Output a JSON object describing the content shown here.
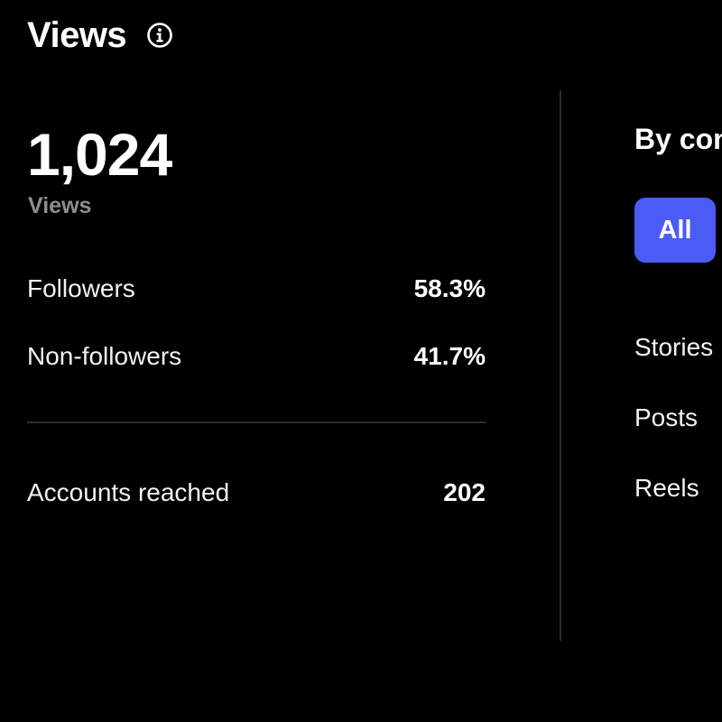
{
  "header": {
    "title": "Views",
    "info_icon": "info-circle-icon"
  },
  "summary": {
    "total": "1,024",
    "total_label": "Views"
  },
  "audience": [
    {
      "label": "Followers",
      "value": "58.3%"
    },
    {
      "label": "Non-followers",
      "value": "41.7%"
    }
  ],
  "reach": {
    "label": "Accounts reached",
    "value": "202"
  },
  "by_content": {
    "heading": "By con",
    "filter_all": "All",
    "types": [
      "Stories",
      "Posts",
      "Reels"
    ]
  },
  "colors": {
    "background": "#000000",
    "accent": "#4b5cf5",
    "muted_text": "#8e8e8e",
    "divider": "#2b2b2b"
  }
}
